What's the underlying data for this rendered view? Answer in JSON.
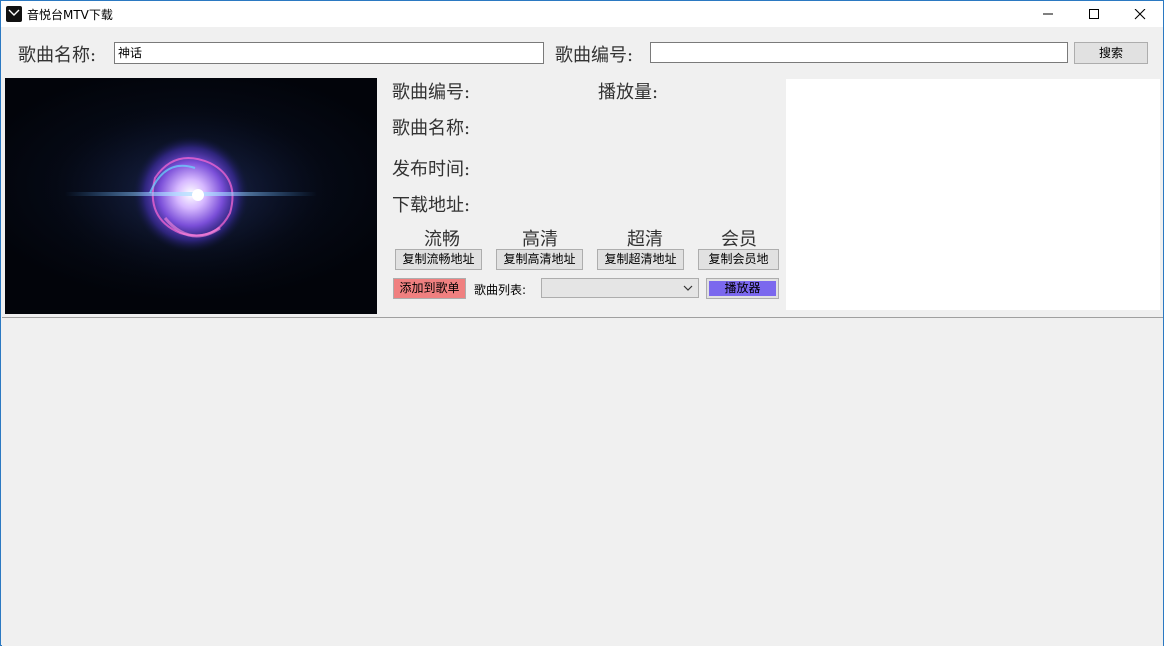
{
  "window": {
    "title": "音悦台MTV下载"
  },
  "search": {
    "name_label": "歌曲名称:",
    "name_value": "神话",
    "id_label": "歌曲编号:",
    "id_value": "",
    "search_button": "搜索"
  },
  "info": {
    "song_id_label": "歌曲编号:",
    "play_count_label": "播放量:",
    "song_name_label": "歌曲名称:",
    "release_time_label": "发布时间:",
    "download_url_label": "下载地址:"
  },
  "qualities": [
    {
      "label": "流畅",
      "copy_button": "复制流畅地址"
    },
    {
      "label": "高清",
      "copy_button": "复制高清地址"
    },
    {
      "label": "超清",
      "copy_button": "复制超清地址"
    },
    {
      "label": "会员",
      "copy_button": "复制会员地"
    }
  ],
  "playlist": {
    "add_button": "添加到歌单",
    "list_label": "歌曲列表:",
    "selected": "",
    "player_button": "播放器"
  },
  "colors": {
    "add_button_bg": "#f08080",
    "player_button_bg": "#7b68ee"
  }
}
